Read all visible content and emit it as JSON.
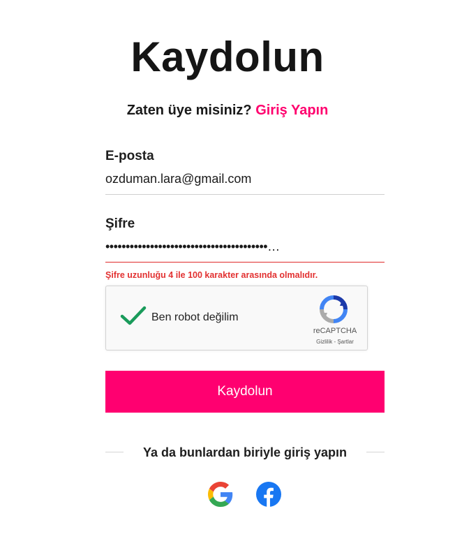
{
  "page": {
    "title": "Kaydolun",
    "already_member": "Zaten üye misiniz?",
    "login_link": "Giriş Yapın"
  },
  "form": {
    "email": {
      "label": "E-posta",
      "value": "ozduman.lara@gmail.com"
    },
    "password": {
      "label": "Şifre",
      "value": "••••••••••••••••••••••••••••••••••••••••…",
      "error": "Şifre uzunluğu 4 ile 100 karakter arasında olmalıdır."
    },
    "recaptcha": {
      "label": "Ben robot değilim",
      "brand": "reCAPTCHA",
      "privacy": "Gizlilik",
      "separator": " - ",
      "terms": "Şartlar",
      "checked": true
    },
    "submit_label": "Kaydolun"
  },
  "social": {
    "divider_text": "Ya da bunlardan biriyle giriş yapın",
    "providers": [
      "google-icon",
      "facebook-icon"
    ]
  },
  "colors": {
    "accent": "#ff0070",
    "error": "#e23131",
    "check": "#1a9b5b",
    "facebook": "#1877f2"
  }
}
